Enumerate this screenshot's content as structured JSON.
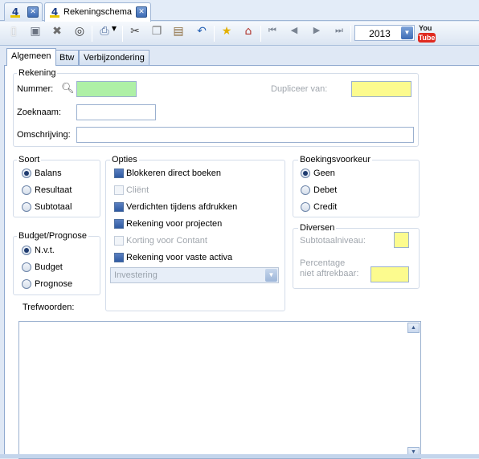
{
  "doc_tabs": [
    {
      "label": "",
      "icon": "app-logo-icon"
    },
    {
      "label": "Rekeningschema",
      "icon": "app-logo-icon"
    }
  ],
  "toolbar": {
    "buttons": [
      "new-document-icon",
      "save-icon",
      "delete-icon",
      "search-binoculars-icon",
      "print-icon",
      "cut-icon",
      "copy-icon",
      "paste-icon",
      "undo-icon",
      "favorite-star-icon",
      "home-add-icon",
      "first-record-icon",
      "previous-record-icon",
      "next-record-icon",
      "last-record-icon"
    ],
    "year": "2013",
    "youtube_you": "You",
    "youtube_tube": "Tube"
  },
  "subtabs": [
    "Algemeen",
    "Btw",
    "Verbijzondering"
  ],
  "rekening": {
    "title": "Rekening",
    "nummer_label": "Nummer:",
    "dupliceer_label": "Dupliceer van:",
    "zoeknaam_label": "Zoeknaam:",
    "omschrijving_label": "Omschrijving:"
  },
  "soort": {
    "title": "Soort",
    "options": [
      "Balans",
      "Resultaat",
      "Subtotaal"
    ],
    "selected": "Balans"
  },
  "budget": {
    "title": "Budget/Prognose",
    "options": [
      "N.v.t.",
      "Budget",
      "Prognose"
    ],
    "selected": "N.v.t."
  },
  "opties": {
    "title": "Opties",
    "items": [
      {
        "label": "Blokkeren direct boeken",
        "enabled": true
      },
      {
        "label": "Cliënt",
        "enabled": false
      },
      {
        "label": "Verdichten tijdens afdrukken",
        "enabled": true
      },
      {
        "label": "Rekening voor projecten",
        "enabled": true
      },
      {
        "label": "Korting voor Contant",
        "enabled": false
      },
      {
        "label": "Rekening voor vaste activa",
        "enabled": true
      }
    ],
    "combo_value": "Investering"
  },
  "boekingsvoorkeur": {
    "title": "Boekingsvoorkeur",
    "options": [
      "Geen",
      "Debet",
      "Credit"
    ],
    "selected": "Geen"
  },
  "diversen": {
    "title": "Diversen",
    "subtotaal_label": "Subtotaalniveau:",
    "percentage_label_1": "Percentage",
    "percentage_label_2": "niet aftrekbaar:"
  },
  "trefwoorden_label": "Trefwoorden:",
  "colors": {
    "accent": "#3d6bb5",
    "field_green": "#aef0a6",
    "field_yellow": "#fcfb8e"
  }
}
